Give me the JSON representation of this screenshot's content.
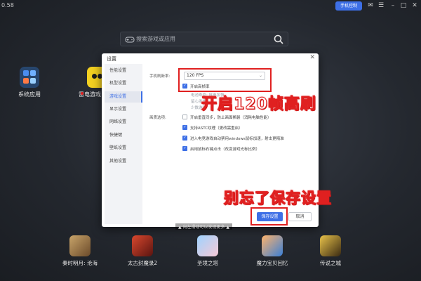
{
  "titlebar": {
    "version": "0.58",
    "phone_control": "手机控制"
  },
  "search": {
    "placeholder": "搜索游戏或应用"
  },
  "desktop_apps": [
    {
      "label": "系统应用"
    },
    {
      "label": "雷电游戏"
    }
  ],
  "dialog": {
    "title": "设置",
    "nav": [
      "性能设置",
      "机型设置",
      "游戏设置",
      "显示设置",
      "网络设置",
      "快捷键",
      "壁纸设置",
      "其他设置"
    ],
    "active_nav": "游戏设置",
    "fps_label": "手机刷新率:",
    "fps_value": "120 FPS",
    "high_fps_label": "开启高帧率",
    "high_fps_checked": true,
    "note_line1": "电池寿命: 耗电加快",
    "note_line2": "留心发热",
    "note_line3": "少数游戏",
    "quality_label": "画质选项:",
    "options": [
      {
        "label": "开启垂直同步，防止画面撕裂（消耗电脑性能）",
        "checked": false
      },
      {
        "label": "支持ASTC纹理（更改需重启）",
        "checked": true
      },
      {
        "label": "进入电竞游戏自动禁用windows鼠标加速，射击更精准",
        "checked": true
      },
      {
        "label": "启用鼠标右键点击（改变游戏光标比例）",
        "checked": true
      }
    ],
    "save_label": "保存设置",
    "cancel_label": "取消"
  },
  "annotations": {
    "top": "开启120帧高刷",
    "bottom": "别忘了保存设置"
  },
  "bottom_hint": "▲ 向左滑动可以发现更多 ▲",
  "games": [
    {
      "label": "秦时明月: 沧海"
    },
    {
      "label": "太古封魔录2"
    },
    {
      "label": "圣境之塔"
    },
    {
      "label": "魔力宝贝回忆"
    },
    {
      "label": "传说之城"
    }
  ],
  "colors": {
    "accent": "#3d6fe6",
    "annotation_red": "#e02020"
  }
}
